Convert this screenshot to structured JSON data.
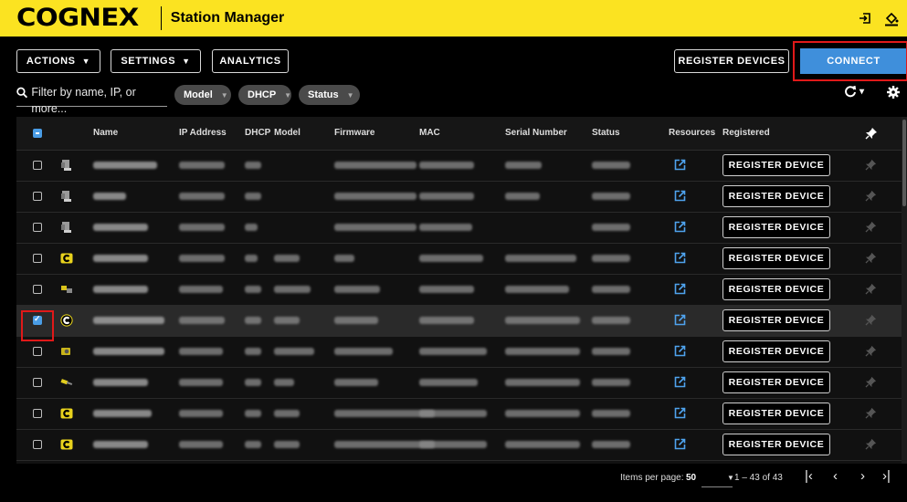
{
  "header": {
    "logo": "COGNEX",
    "title": "Station Manager"
  },
  "toolbar": {
    "actions": "ACTIONS",
    "settings": "SETTINGS",
    "analytics": "ANALYTICS",
    "register_devices": "REGISTER DEVICES",
    "connect": "CONNECT"
  },
  "filter": {
    "placeholder": "Filter by name, IP, or more...",
    "chips": [
      "Model",
      "DHCP",
      "Status"
    ]
  },
  "refresh_caret": "▾",
  "table": {
    "columns": [
      "Name",
      "IP Address",
      "DHCP",
      "Model",
      "Firmware",
      "MAC",
      "Serial Number",
      "Status",
      "Resources",
      "Registered"
    ],
    "rows": [
      {
        "device": "generic",
        "checked": false,
        "blur_widths": [
          70,
          50,
          18,
          0,
          90,
          60,
          40,
          42
        ]
      },
      {
        "device": "generic",
        "checked": false,
        "blur_widths": [
          36,
          50,
          18,
          0,
          90,
          60,
          38,
          42
        ]
      },
      {
        "device": "generic",
        "checked": false,
        "blur_widths": [
          60,
          50,
          14,
          0,
          90,
          58,
          0,
          42
        ]
      },
      {
        "device": "cognex-yellow",
        "checked": false,
        "blur_widths": [
          60,
          50,
          14,
          28,
          22,
          70,
          78,
          42
        ]
      },
      {
        "device": "vision-small",
        "checked": false,
        "blur_widths": [
          60,
          48,
          18,
          40,
          50,
          60,
          70,
          42
        ]
      },
      {
        "device": "cognex-black",
        "checked": true,
        "blur_widths": [
          78,
          50,
          18,
          28,
          48,
          60,
          82,
          42
        ]
      },
      {
        "device": "camera-yellow",
        "checked": false,
        "blur_widths": [
          78,
          48,
          18,
          44,
          64,
          74,
          82,
          42
        ]
      },
      {
        "device": "wand-yellow",
        "checked": false,
        "blur_widths": [
          60,
          48,
          18,
          22,
          48,
          64,
          82,
          42
        ]
      },
      {
        "device": "cognex-yellow",
        "checked": false,
        "blur_widths": [
          64,
          48,
          18,
          28,
          110,
          74,
          82,
          42
        ]
      },
      {
        "device": "cognex-yellow",
        "checked": false,
        "blur_widths": [
          60,
          48,
          18,
          28,
          110,
          74,
          82,
          42
        ]
      }
    ],
    "register_label": "REGISTER DEVICE"
  },
  "pagination": {
    "items_per_page_label": "Items per page:",
    "items_per_page": "50",
    "range": "1 – 43 of 43"
  },
  "colors": {
    "header": "#fbe321",
    "accent": "#3f8fdb",
    "highlight": "#e01919"
  }
}
